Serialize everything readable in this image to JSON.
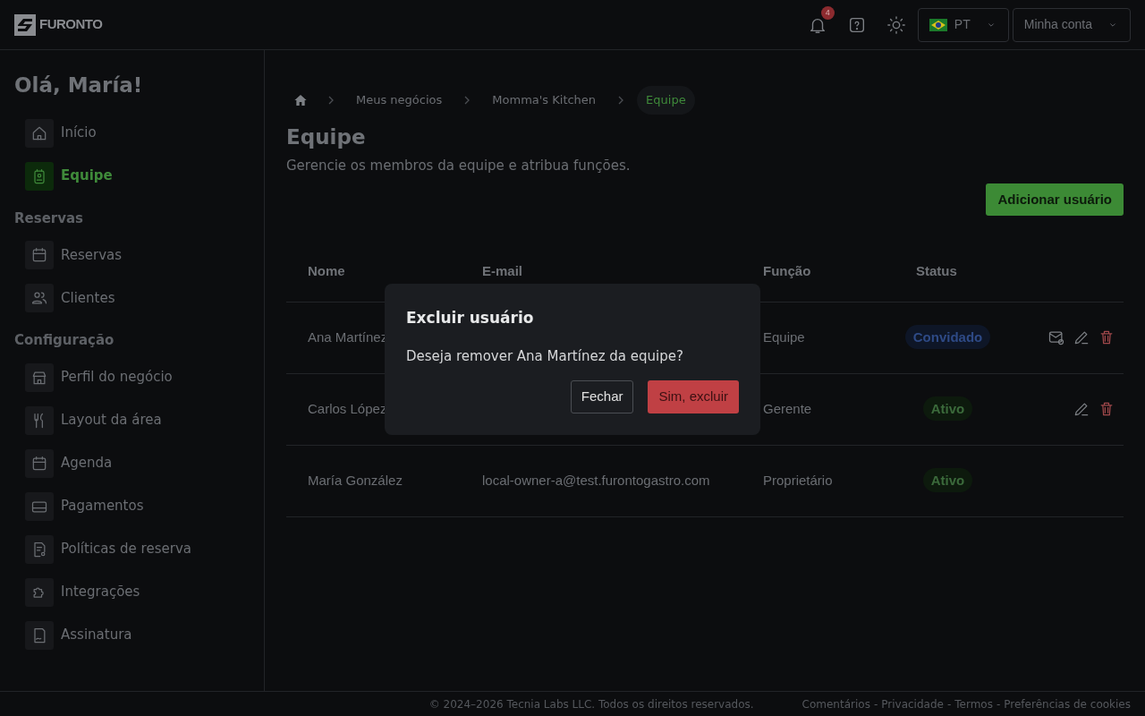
{
  "brand": "FURONTO",
  "topbar": {
    "notifications": "4",
    "language": "PT",
    "account": "Minha conta"
  },
  "sidebar": {
    "greeting": "Olá, María!",
    "sections": [
      {
        "items": [
          {
            "label": "Início",
            "selected": false
          },
          {
            "label": "Equipe",
            "selected": true
          }
        ]
      },
      {
        "title": "Reservas",
        "items": [
          {
            "label": "Reservas",
            "selected": false
          },
          {
            "label": "Clientes",
            "selected": false
          }
        ]
      },
      {
        "title": "Configuração",
        "items": [
          {
            "label": "Perfil do negócio",
            "selected": false
          },
          {
            "label": "Layout da área",
            "selected": false
          },
          {
            "label": "Agenda",
            "selected": false
          },
          {
            "label": "Pagamentos",
            "selected": false
          },
          {
            "label": "Políticas de reserva",
            "selected": false
          },
          {
            "label": "Integrações",
            "selected": false
          },
          {
            "label": "Assinatura",
            "selected": false
          }
        ]
      }
    ]
  },
  "breadcrumb": [
    {
      "label": "Meus negócios",
      "selected": false
    },
    {
      "label": "Momma's Kitchen",
      "selected": false
    },
    {
      "label": "Equipe",
      "selected": true
    }
  ],
  "page": {
    "title": "Equipe",
    "subtitle": "Gerencie os membros da equipe e atribua funções.",
    "add_button": "Adicionar usuário"
  },
  "table": {
    "columns": [
      "Nome",
      "E-mail",
      "Função",
      "Status"
    ],
    "rows": [
      {
        "name": "Ana Martínez",
        "role": "Equipe",
        "status": {
          "label": "Convidado",
          "kind": "invited"
        },
        "actions": [
          {
            "kind": "resend"
          },
          {
            "kind": "edit"
          },
          {
            "kind": "delete"
          }
        ]
      },
      {
        "name": "Carlos López",
        "role": "Gerente",
        "status": {
          "label": "Ativo",
          "kind": "active"
        },
        "actions": [
          {
            "kind": "edit"
          },
          {
            "kind": "delete"
          }
        ]
      },
      {
        "name": "María González",
        "email": "local-owner-a@test.furontogastro.com",
        "role": "Proprietário",
        "status": {
          "label": "Ativo",
          "kind": "active"
        }
      }
    ]
  },
  "modal": {
    "title": "Excluir usuário",
    "message": "Deseja remover Ana Martínez da equipe?",
    "cancel": "Fechar",
    "confirm": "Sim, excluir"
  },
  "footer": {
    "copyright": "© 2024–2026 Tecnia Labs LLC. Todos os direitos reservados.",
    "links": [
      "Comentários",
      "Privacidade",
      "Termos",
      "Preferências de cookies"
    ],
    "separator": "-"
  }
}
